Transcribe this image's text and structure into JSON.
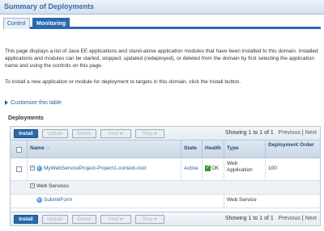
{
  "header": {
    "title": "Summary of Deployments"
  },
  "tabs": [
    {
      "label": "Control"
    },
    {
      "label": "Monitoring"
    }
  ],
  "intro": {
    "paragraph1": "This page displays a list of Java EE applications and stand-alone application modules that have been installed to this domain. Installed applications and modules can be started, stopped, updated (redeployed), or deleted from the domain by first selecting the application name and using the controls on this page.",
    "paragraph2": "To install a new application or module for deployment to targets in this domain, click the Install button."
  },
  "customize_link": "Customize this table",
  "section_title": "Deployments",
  "toolbar": {
    "install": "Install",
    "update": "Update",
    "delete": "Delete",
    "start": "Start",
    "stop": "Stop",
    "showing": "Showing 1 to 1 of 1",
    "previous": "Previous",
    "separator": "|",
    "next": "Next"
  },
  "columns": {
    "name": "Name",
    "sort_icon": "⇔",
    "state": "State",
    "health": "Health",
    "type": "Type",
    "deployment_order": "Deployment Order"
  },
  "rows": [
    {
      "name": "MyWebServiceProject-Project1-context-root",
      "state": "Active",
      "health": "OK",
      "type": "Web Application",
      "deployment_order": "100"
    }
  ],
  "subrows": {
    "group_label": "Web Services",
    "service_name": "SubmitForm",
    "service_type": "Web Service"
  }
}
